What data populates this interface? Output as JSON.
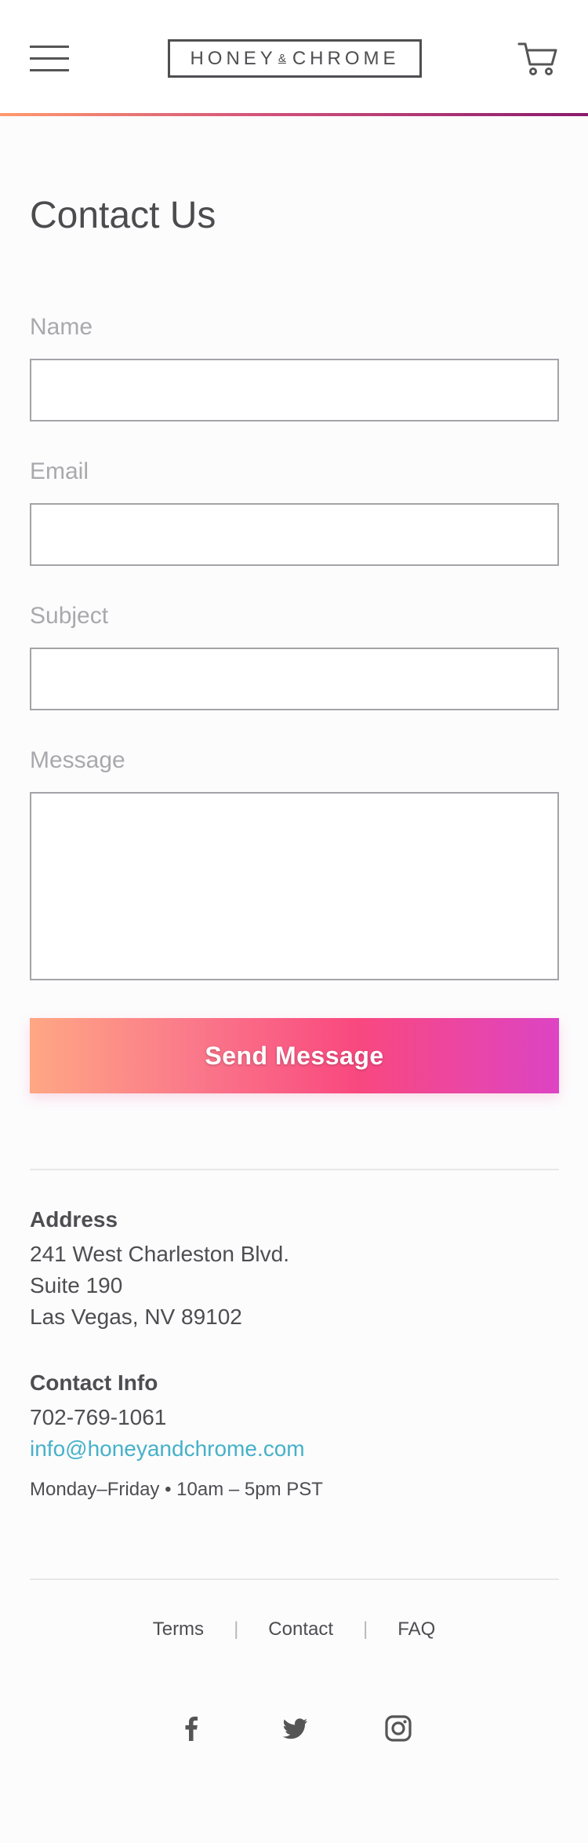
{
  "header": {
    "menu_icon": "hamburger-menu-icon",
    "brand": {
      "left": "HONEY",
      "amp": "&",
      "right": "CHROME"
    },
    "cart_icon": "shopping-cart-icon",
    "accent_gradient": [
      "#ff9a6e",
      "#d3527a",
      "#8a1a6e"
    ]
  },
  "page": {
    "title": "Contact Us"
  },
  "form": {
    "name_label": "Name",
    "email_label": "Email",
    "subject_label": "Subject",
    "message_label": "Message",
    "name_value": "",
    "email_value": "",
    "subject_value": "",
    "message_value": "",
    "submit_label": "Send Message",
    "submit_gradient": [
      "#ffa784",
      "#f9487f",
      "#dd44c4"
    ]
  },
  "address": {
    "heading": "Address",
    "line1": "241 West Charleston Blvd.",
    "line2": "Suite 190",
    "line3": "Las Vegas, NV 89102"
  },
  "contact_info": {
    "heading": "Contact Info",
    "phone": "702-769-1061",
    "email": "info@honeyandchrome.com",
    "hours": "Monday–Friday • 10am – 5pm PST",
    "link_color": "#46b1c9"
  },
  "footer": {
    "links": [
      "Terms",
      "Contact",
      "FAQ"
    ],
    "separator": "|",
    "social_icons": [
      "facebook-icon",
      "twitter-icon",
      "instagram-icon"
    ]
  }
}
